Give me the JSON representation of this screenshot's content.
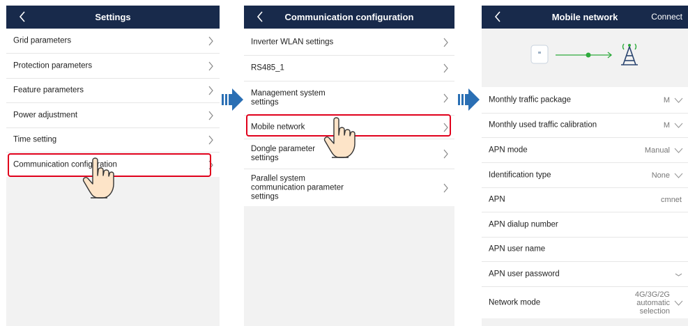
{
  "screen1": {
    "title": "Settings",
    "items": [
      {
        "label": "Grid parameters"
      },
      {
        "label": "Protection parameters"
      },
      {
        "label": "Feature parameters"
      },
      {
        "label": "Power adjustment"
      },
      {
        "label": "Time setting"
      },
      {
        "label": "Communication configuration"
      }
    ]
  },
  "screen2": {
    "title": "Communication configuration",
    "items": [
      {
        "label": "Inverter WLAN settings"
      },
      {
        "label": "RS485_1"
      },
      {
        "label": "Management system settings"
      },
      {
        "label": "Mobile network"
      },
      {
        "label": "Dongle parameter settings"
      },
      {
        "label": "Parallel system communication parameter settings"
      }
    ]
  },
  "screen3": {
    "title": "Mobile network",
    "action": "Connect",
    "items": [
      {
        "label": "Monthly traffic package",
        "value": "M"
      },
      {
        "label": "Monthly used traffic calibration",
        "value": "M"
      },
      {
        "label": "APN mode",
        "value": "Manual"
      },
      {
        "label": "Identification type",
        "value": "None"
      },
      {
        "label": "APN",
        "value": "cmnet"
      },
      {
        "label": "APN dialup number",
        "value": ""
      },
      {
        "label": "APN user name",
        "value": ""
      },
      {
        "label": "APN user password",
        "value": ""
      },
      {
        "label": "Network mode",
        "value": "4G/3G/2G automatic selection"
      }
    ]
  },
  "colors": {
    "header_bg": "#182a4b",
    "highlight": "#e0001b",
    "arrow": "#2a6fb4",
    "connection": "#2eaa3c"
  }
}
